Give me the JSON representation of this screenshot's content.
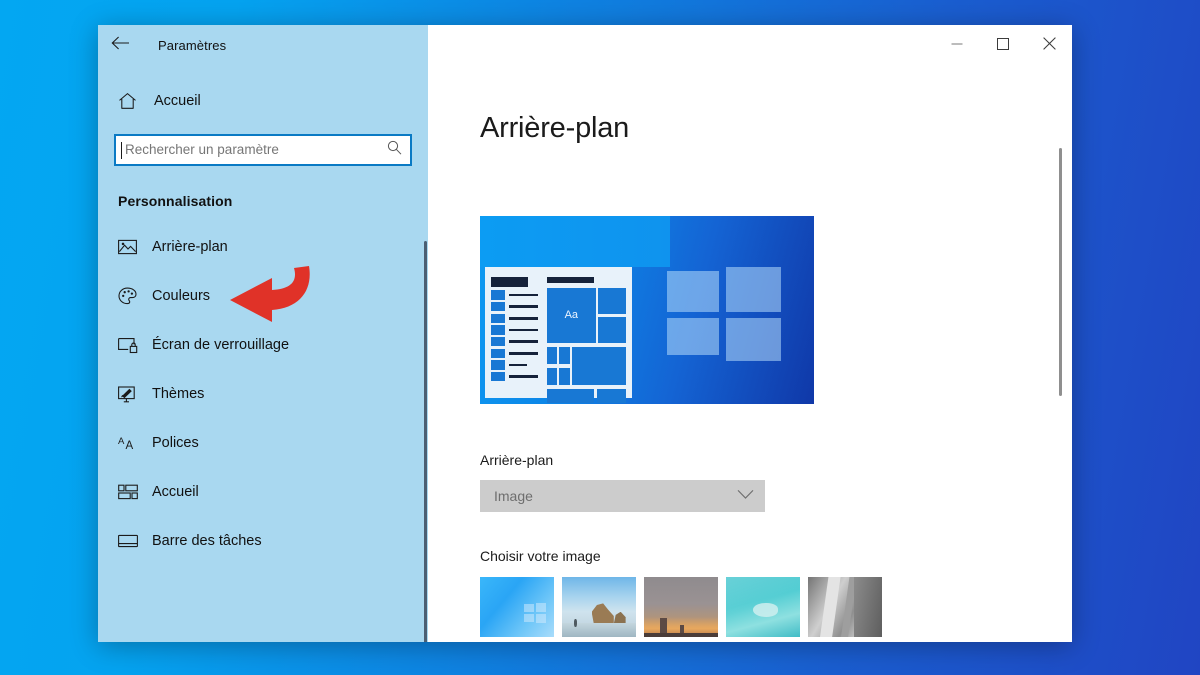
{
  "window": {
    "title": "Paramètres",
    "back_icon": "back-arrow-icon",
    "controls": {
      "minimize": "minimize-icon",
      "maximize": "maximize-icon",
      "close": "close-icon"
    }
  },
  "sidebar": {
    "home": {
      "label": "Accueil",
      "icon": "home-icon"
    },
    "search": {
      "placeholder": "Rechercher un paramètre",
      "value": "",
      "icon": "search-icon"
    },
    "section_title": "Personnalisation",
    "items": [
      {
        "label": "Arrière-plan",
        "icon": "picture-icon",
        "selected": true
      },
      {
        "label": "Couleurs",
        "icon": "palette-icon",
        "selected": false
      },
      {
        "label": "Écran de verrouillage",
        "icon": "lockscreen-icon",
        "selected": false
      },
      {
        "label": "Thèmes",
        "icon": "themes-icon",
        "selected": false
      },
      {
        "label": "Polices",
        "icon": "fonts-icon",
        "selected": false
      },
      {
        "label": "Accueil",
        "icon": "start-tiles-icon",
        "selected": false
      },
      {
        "label": "Barre des tâches",
        "icon": "taskbar-icon",
        "selected": false
      }
    ]
  },
  "content": {
    "page_title": "Arrière-plan",
    "preview_alt": "wallpaper-preview",
    "preview_tile_text": "Aa",
    "background_field": {
      "label": "Arrière-plan",
      "selected_value": "Image",
      "chevron": "chevron-down-icon"
    },
    "choose_image": {
      "label": "Choisir votre image",
      "thumbnails": [
        {
          "name": "windows-default-wallpaper",
          "selected": true
        },
        {
          "name": "beach-rock-wallpaper",
          "selected": false
        },
        {
          "name": "dusk-skyline-wallpaper",
          "selected": false
        },
        {
          "name": "underwater-wallpaper",
          "selected": false
        },
        {
          "name": "rock-face-wallpaper",
          "selected": false
        }
      ]
    }
  },
  "annotation": {
    "arrow": "red-curved-arrow-pointing-to-couleurs",
    "color": "#e03228"
  },
  "colors": {
    "desktop_gradient_start": "#03a7f2",
    "desktop_gradient_end": "#2045c3",
    "sidebar_bg": "#a9d8f0",
    "accent": "#1380d4",
    "search_border": "#0a7ac4",
    "dropdown_bg": "#cccccc"
  }
}
